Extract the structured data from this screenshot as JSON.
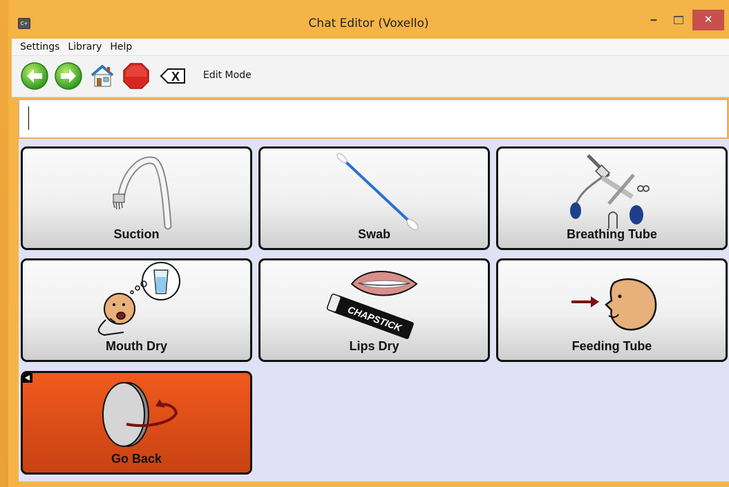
{
  "window": {
    "title": "Chat Editor (Voxello)",
    "icon_text": "C+",
    "minimize_glyph": "‒",
    "close_glyph": "✕"
  },
  "menu": [
    "Settings",
    "Library",
    "Help"
  ],
  "toolbar": {
    "buttons": [
      "back-arrow-icon",
      "forward-arrow-icon",
      "home-icon",
      "stop-sign-icon",
      "clear-text-icon"
    ],
    "clear_glyph": "X",
    "edit_mode_label": "Edit Mode"
  },
  "message_bar": {
    "value": ""
  },
  "grid": {
    "cells": [
      {
        "label": "Suction",
        "icon": "suction-tube-icon"
      },
      {
        "label": "Swab",
        "icon": "swab-icon"
      },
      {
        "label": "Breathing Tube",
        "icon": "breathing-tube-icon"
      },
      {
        "label": "Mouth Dry",
        "icon": "mouth-dry-icon"
      },
      {
        "label": "Lips Dry",
        "icon": "lips-chapstick-icon",
        "icon_text": "CHAPSTICK"
      },
      {
        "label": "Feeding Tube",
        "icon": "feeding-tube-icon"
      },
      {
        "label": "Go Back",
        "icon": "go-back-icon"
      }
    ]
  },
  "colors": {
    "window_frame": "#f4b447",
    "grid_background": "#e1e1f6",
    "go_back_button": "#e2521a",
    "close_button": "#c7504c"
  }
}
